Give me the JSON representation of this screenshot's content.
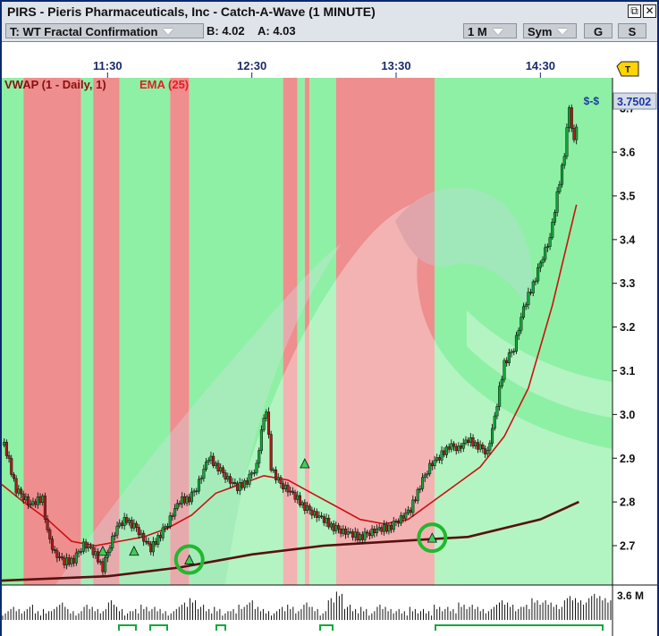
{
  "window": {
    "title": "PIRS - Pieris Pharmaceuticals, Inc - Catch-A-Wave (1 MINUTE)",
    "controls": {
      "restore": "⧉",
      "close": "✕"
    }
  },
  "toolbar": {
    "template": "T: WT Fractal Confirmation",
    "bid": "B: 4.02",
    "ask": "A: 4.03",
    "interval": "1 M",
    "sym": "Sym",
    "g": "G",
    "s": "S"
  },
  "indicators": {
    "vwap": "VWAP (1 - Daily, 1)",
    "ema": "EMA (25)"
  },
  "labels": {
    "alert": "$-$",
    "last_price": "3.7502",
    "volume_axis": "3.6 M",
    "flag": "T"
  },
  "colors": {
    "bull_bg": "#8ef0a4",
    "bear_bg": "#ee8e8e",
    "ema": "#cc1010",
    "vwap": "#5a1010",
    "up_candle": "#12a83a",
    "down_candle": "#b81818",
    "signal_circle": "#22b830"
  },
  "chart_data": {
    "type": "candlestick",
    "title": "PIRS - Pieris Pharmaceuticals, Inc - Catch-A-Wave (1 MINUTE)",
    "x_ticks": [
      "11:30",
      "12:30",
      "13:30",
      "14:30"
    ],
    "y_ticks": [
      2.7,
      2.8,
      2.9,
      3.0,
      3.1,
      3.2,
      3.3,
      3.4,
      3.5,
      3.6,
      3.7
    ],
    "ylim": [
      2.61,
      3.77
    ],
    "time_range": [
      "10:46",
      "15:00"
    ],
    "last_price": 3.7502,
    "volume_axis_max": "3.6 M",
    "price_path": [
      [
        "10:47",
        2.93
      ],
      [
        "10:52",
        2.83
      ],
      [
        "10:58",
        2.79
      ],
      [
        "11:03",
        2.81
      ],
      [
        "11:05",
        2.73
      ],
      [
        "11:08",
        2.68
      ],
      [
        "11:12",
        2.66
      ],
      [
        "11:16",
        2.67
      ],
      [
        "11:20",
        2.7
      ],
      [
        "11:23",
        2.69
      ],
      [
        "11:26",
        2.67
      ],
      [
        "11:28",
        2.65
      ],
      [
        "11:31",
        2.7
      ],
      [
        "11:34",
        2.74
      ],
      [
        "11:38",
        2.76
      ],
      [
        "11:42",
        2.74
      ],
      [
        "11:44",
        2.72
      ],
      [
        "11:48",
        2.69
      ],
      [
        "11:51",
        2.72
      ],
      [
        "11:55",
        2.75
      ],
      [
        "12:00",
        2.8
      ],
      [
        "12:04",
        2.81
      ],
      [
        "12:07",
        2.83
      ],
      [
        "12:10",
        2.87
      ],
      [
        "12:12",
        2.9
      ],
      [
        "12:16",
        2.88
      ],
      [
        "12:20",
        2.85
      ],
      [
        "12:24",
        2.83
      ],
      [
        "12:28",
        2.85
      ],
      [
        "12:32",
        2.88
      ],
      [
        "12:34",
        2.96
      ],
      [
        "12:36",
        3.01
      ],
      [
        "12:38",
        2.88
      ],
      [
        "12:42",
        2.84
      ],
      [
        "12:46",
        2.82
      ],
      [
        "12:52",
        2.79
      ],
      [
        "12:56",
        2.77
      ],
      [
        "13:02",
        2.75
      ],
      [
        "13:08",
        2.73
      ],
      [
        "13:14",
        2.72
      ],
      [
        "13:20",
        2.73
      ],
      [
        "13:26",
        2.74
      ],
      [
        "13:32",
        2.76
      ],
      [
        "13:36",
        2.78
      ],
      [
        "13:40",
        2.84
      ],
      [
        "13:44",
        2.88
      ],
      [
        "13:48",
        2.9
      ],
      [
        "13:52",
        2.93
      ],
      [
        "13:56",
        2.92
      ],
      [
        "14:00",
        2.94
      ],
      [
        "14:04",
        2.93
      ],
      [
        "14:08",
        2.91
      ],
      [
        "14:11",
        2.99
      ],
      [
        "14:15",
        3.12
      ],
      [
        "14:19",
        3.15
      ],
      [
        "14:23",
        3.24
      ],
      [
        "14:27",
        3.3
      ],
      [
        "14:31",
        3.36
      ],
      [
        "14:34",
        3.4
      ],
      [
        "14:37",
        3.5
      ],
      [
        "14:40",
        3.6
      ],
      [
        "14:42",
        3.7
      ],
      [
        "14:44",
        3.62
      ],
      [
        "14:46",
        3.7
      ]
    ],
    "series": [
      {
        "name": "EMA (25)",
        "values": [
          [
            "10:46",
            2.84
          ],
          [
            "10:55",
            2.8
          ],
          [
            "11:05",
            2.76
          ],
          [
            "11:15",
            2.71
          ],
          [
            "11:25",
            2.7
          ],
          [
            "11:35",
            2.71
          ],
          [
            "11:45",
            2.72
          ],
          [
            "11:55",
            2.74
          ],
          [
            "12:05",
            2.77
          ],
          [
            "12:15",
            2.82
          ],
          [
            "12:25",
            2.84
          ],
          [
            "12:35",
            2.86
          ],
          [
            "12:45",
            2.85
          ],
          [
            "12:55",
            2.82
          ],
          [
            "13:05",
            2.79
          ],
          [
            "13:15",
            2.76
          ],
          [
            "13:25",
            2.75
          ],
          [
            "13:35",
            2.76
          ],
          [
            "13:45",
            2.8
          ],
          [
            "13:55",
            2.84
          ],
          [
            "14:05",
            2.88
          ],
          [
            "14:15",
            2.95
          ],
          [
            "14:25",
            3.06
          ],
          [
            "14:35",
            3.25
          ],
          [
            "14:45",
            3.48
          ]
        ]
      },
      {
        "name": "VWAP (1 - Daily, 1)",
        "values": [
          [
            "10:46",
            2.62
          ],
          [
            "11:30",
            2.63
          ],
          [
            "12:00",
            2.65
          ],
          [
            "12:30",
            2.68
          ],
          [
            "13:00",
            2.7
          ],
          [
            "13:30",
            2.71
          ],
          [
            "14:00",
            2.72
          ],
          [
            "14:30",
            2.76
          ],
          [
            "14:46",
            2.8
          ]
        ]
      }
    ],
    "zones": [
      {
        "state": "bull",
        "from": "10:46",
        "to": "10:55"
      },
      {
        "state": "bear",
        "from": "10:55",
        "to": "11:19"
      },
      {
        "state": "bull",
        "from": "11:19",
        "to": "11:24"
      },
      {
        "state": "bear",
        "from": "11:24",
        "to": "11:35"
      },
      {
        "state": "bull",
        "from": "11:35",
        "to": "11:56"
      },
      {
        "state": "bear",
        "from": "11:56",
        "to": "12:04"
      },
      {
        "state": "bull",
        "from": "12:04",
        "to": "12:43"
      },
      {
        "state": "bear",
        "from": "12:43",
        "to": "12:49"
      },
      {
        "state": "bull",
        "from": "12:49",
        "to": "12:52"
      },
      {
        "state": "bear",
        "from": "12:52",
        "to": "12:54"
      },
      {
        "state": "bull",
        "from": "12:54",
        "to": "13:05"
      },
      {
        "state": "bear",
        "from": "13:05",
        "to": "13:46"
      },
      {
        "state": "bull",
        "from": "13:46",
        "to": "15:00"
      }
    ],
    "signals": [
      {
        "time": "11:28",
        "price": 2.68,
        "circled": false
      },
      {
        "time": "11:41",
        "price": 2.68,
        "circled": false
      },
      {
        "time": "12:04",
        "price": 2.66,
        "circled": true
      },
      {
        "time": "12:52",
        "price": 2.88,
        "circled": false
      },
      {
        "time": "13:45",
        "price": 2.71,
        "circled": true
      }
    ],
    "volume": [
      3,
      5,
      4,
      6,
      3,
      4,
      5,
      7,
      4,
      3,
      6,
      5,
      4,
      8,
      5,
      3,
      4,
      6,
      5,
      4,
      3,
      5,
      7,
      9,
      6,
      4,
      5,
      3,
      4,
      6,
      8,
      5,
      4,
      3,
      5,
      6,
      4,
      7,
      5,
      3,
      9,
      12,
      6,
      4,
      5,
      3,
      6,
      5,
      4,
      3,
      5,
      4,
      3,
      6,
      5,
      4,
      7,
      6,
      5,
      4,
      6,
      8,
      7,
      5,
      6,
      9,
      8,
      7,
      6,
      10,
      9,
      8,
      11,
      10,
      9
    ],
    "legend": [
      "VWAP (1 - Daily, 1)",
      "EMA (25)"
    ]
  }
}
